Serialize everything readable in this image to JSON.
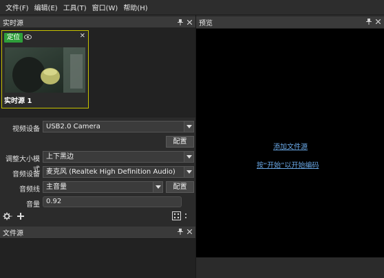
{
  "menu": [
    "文件(F)",
    "编辑(E)",
    "工具(T)",
    "窗口(W)",
    "帮助(H)"
  ],
  "realtime_panel": {
    "title": "实时源",
    "source": {
      "badge": "定位",
      "label": "实时源 1"
    }
  },
  "form": {
    "video_device_label": "视频设备",
    "video_device_value": "USB2.0 Camera",
    "config_button": "配置",
    "resize_mode_label": "调整大小模式",
    "resize_mode_value": "上下黑边",
    "audio_device_label": "音频设备",
    "audio_device_value": "麦克风 (Realtek High Definition Audio)",
    "audio_line_label": "音频线",
    "audio_line_value": "主音量",
    "audio_config_button": "配置",
    "volume_label": "音量",
    "volume_value": "0.92"
  },
  "file_panel": {
    "title": "文件源"
  },
  "preview_panel": {
    "title": "预览",
    "add_file_link": "添加文件源",
    "start_link": "按“开始”以开始编码"
  },
  "colors": {
    "accent_border": "#c8c400",
    "badge_green": "#2e9e3a",
    "link_blue": "#6aa8e6"
  }
}
